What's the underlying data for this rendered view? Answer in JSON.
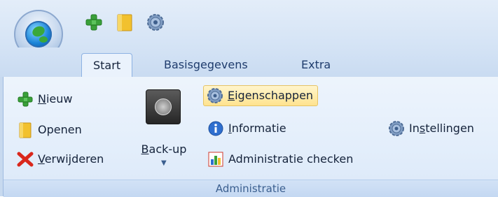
{
  "app": {
    "quick_access": [
      {
        "icon": "plus-icon",
        "color": "#3aa03a"
      },
      {
        "icon": "folder-icon",
        "color": "#f2c12e"
      },
      {
        "icon": "gear-icon",
        "color": "#6f8fb8"
      }
    ]
  },
  "tabs": [
    {
      "label": "Start",
      "active": true
    },
    {
      "label": "Basisgegevens",
      "active": false
    },
    {
      "label": "Extra",
      "active": false
    }
  ],
  "ribbon": {
    "group_label": "Administratie",
    "buttons": {
      "nieuw": {
        "first": "N",
        "rest": "ieuw"
      },
      "openen": {
        "text": "Openen"
      },
      "verwijderen": {
        "first": "V",
        "rest": "erwijderen"
      },
      "backup": {
        "first": "B",
        "rest": "ack-up"
      },
      "eigenschappen": {
        "first": "E",
        "rest": "igenschappen"
      },
      "informatie": {
        "first": "I",
        "rest": "nformatie"
      },
      "admin_check": {
        "text": "Administratie checken"
      },
      "instellingen": {
        "pre": "In",
        "first": "s",
        "rest": "tellingen"
      }
    }
  }
}
